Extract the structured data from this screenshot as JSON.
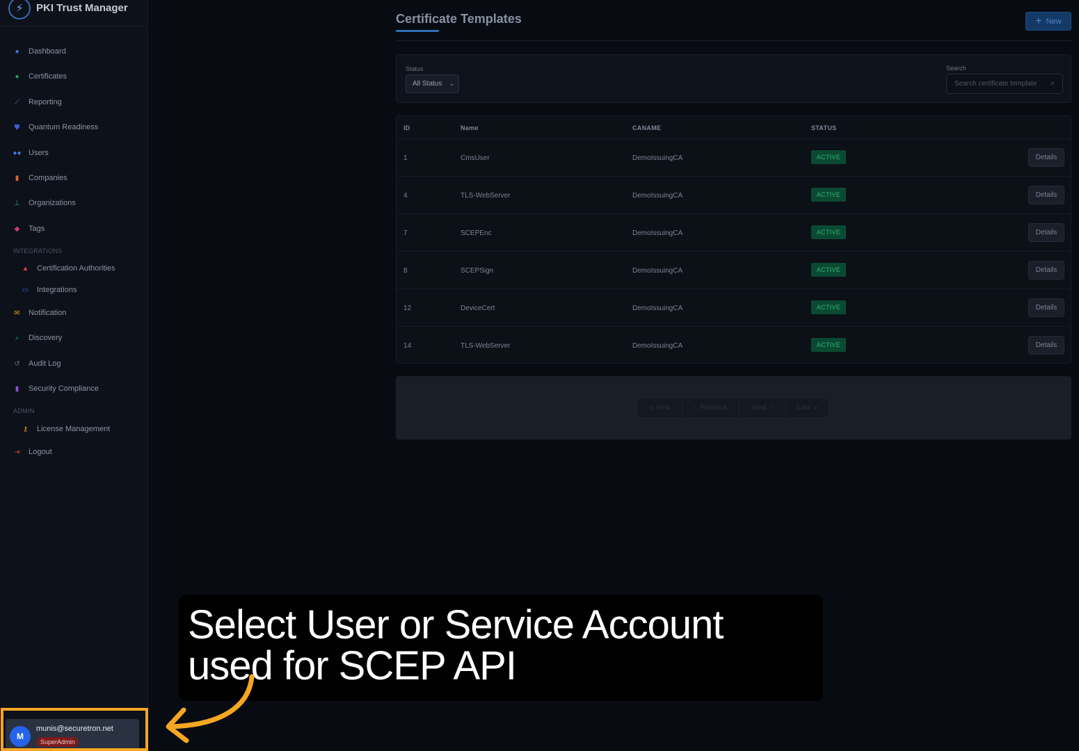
{
  "brand": {
    "title": "PKI Trust Manager"
  },
  "sidebar": {
    "items": [
      {
        "label": "Dashboard",
        "icon": "dashboard-icon",
        "color": "#3b7dd8"
      },
      {
        "label": "Certificates",
        "icon": "certificate-icon",
        "color": "#22a35a"
      },
      {
        "label": "Reporting",
        "icon": "chart-icon",
        "color": "#8b4fd6"
      },
      {
        "label": "Quantum Readiness",
        "icon": "shield-icon",
        "color": "#3b5fd8"
      },
      {
        "label": "Users",
        "icon": "users-icon",
        "color": "#3b7dd8"
      },
      {
        "label": "Companies",
        "icon": "building-icon",
        "color": "#d8682a"
      },
      {
        "label": "Organizations",
        "icon": "sitemap-icon",
        "color": "#22a37a"
      },
      {
        "label": "Tags",
        "icon": "tag-icon",
        "color": "#d83b7a"
      }
    ],
    "integrations_header": "INTEGRATIONS",
    "integrations": [
      {
        "label": "Certification Authorities",
        "icon": "lock-icon",
        "color": "#d83b3b"
      },
      {
        "label": "Integrations",
        "icon": "integration-icon",
        "color": "#3b5fd8"
      }
    ],
    "items2": [
      {
        "label": "Notification",
        "icon": "envelope-icon",
        "color": "#d89a2a"
      },
      {
        "label": "Discovery",
        "icon": "search-icon",
        "color": "#22a35a"
      },
      {
        "label": "Audit Log",
        "icon": "history-icon",
        "color": "#6d7686"
      },
      {
        "label": "Security Compliance",
        "icon": "clipboard-icon",
        "color": "#8b4fd6"
      }
    ],
    "admin_header": "ADMIN",
    "admin": [
      {
        "label": "License Management",
        "icon": "key-icon",
        "color": "#d89a2a"
      }
    ],
    "logout": {
      "label": "Logout",
      "icon": "logout-icon",
      "color": "#d83b3b"
    }
  },
  "user": {
    "initial": "M",
    "email": "munis@securetron.net",
    "role": "SuperAdmin"
  },
  "page": {
    "title": "Certificate Templates",
    "new_label": "New"
  },
  "filters": {
    "status_label": "Status",
    "status_value": "All Status",
    "search_label": "Search",
    "search_placeholder": "Search certificate template"
  },
  "table": {
    "headers": {
      "id": "ID",
      "name": "Name",
      "caname": "CANAME",
      "status": "STATUS"
    },
    "details_label": "Details",
    "rows": [
      {
        "id": "1",
        "name": "CmsUser",
        "caname": "DemoIssuingCA",
        "status": "ACTIVE"
      },
      {
        "id": "4",
        "name": "TLS-WebServer",
        "caname": "DemoIssuingCA",
        "status": "ACTIVE"
      },
      {
        "id": "7",
        "name": "SCEPEnc",
        "caname": "DemoIssuingCA",
        "status": "ACTIVE"
      },
      {
        "id": "8",
        "name": "SCEPSign",
        "caname": "DemoIssuingCA",
        "status": "ACTIVE"
      },
      {
        "id": "12",
        "name": "DeviceCert",
        "caname": "DemoIssuingCA",
        "status": "ACTIVE"
      },
      {
        "id": "14",
        "name": "TLS-WebServer",
        "caname": "DemoIssuingCA",
        "status": "ACTIVE"
      }
    ]
  },
  "pager": {
    "first": "First",
    "previous": "Previous",
    "next": "Next",
    "last": "Last"
  },
  "caption": {
    "text": "Select User or Service Account used for SCEP API"
  },
  "colors": {
    "highlight": "#f5a623",
    "accent": "#2f6fb8",
    "active_badge": "#2eb37a"
  }
}
